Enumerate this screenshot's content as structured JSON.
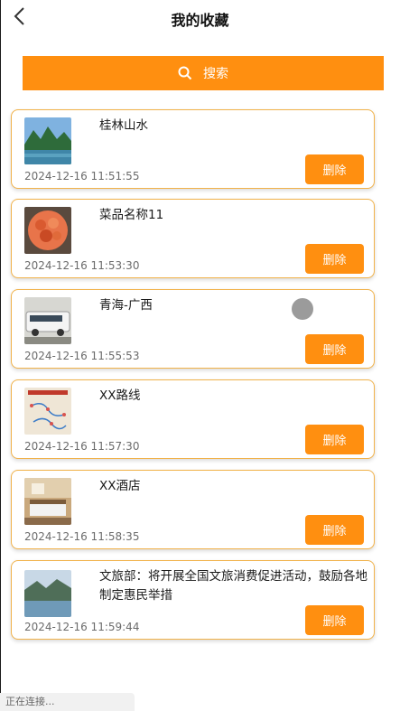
{
  "header": {
    "title": "我的收藏",
    "back_icon": "chevron-left-icon"
  },
  "search": {
    "label": "搜索",
    "icon": "search-icon"
  },
  "favorites": [
    {
      "name": "桂林山水",
      "time": "2024-12-16 11:51:55",
      "delete_label": "删除",
      "thumb": "landscape-photo"
    },
    {
      "name": "菜品名称11",
      "time": "2024-12-16 11:53:30",
      "delete_label": "删除",
      "thumb": "dish-photo"
    },
    {
      "name": "青海-广西",
      "time": "2024-12-16 11:55:53",
      "delete_label": "删除",
      "thumb": "bus-photo"
    },
    {
      "name": "XX路线",
      "time": "2024-12-16 11:57:30",
      "delete_label": "删除",
      "thumb": "route-map-photo"
    },
    {
      "name": "XX酒店",
      "time": "2024-12-16 11:58:35",
      "delete_label": "删除",
      "thumb": "hotel-room-photo"
    },
    {
      "name": "文旅部：将开展全国文旅消费促进活动，鼓励各地制定惠民举措",
      "time": "2024-12-16 11:59:44",
      "delete_label": "删除",
      "thumb": "lake-landscape-photo"
    }
  ],
  "status_bar": {
    "text": "正在连接..."
  },
  "colors": {
    "accent": "#ff8f10",
    "card_border": "#f1b24a"
  }
}
